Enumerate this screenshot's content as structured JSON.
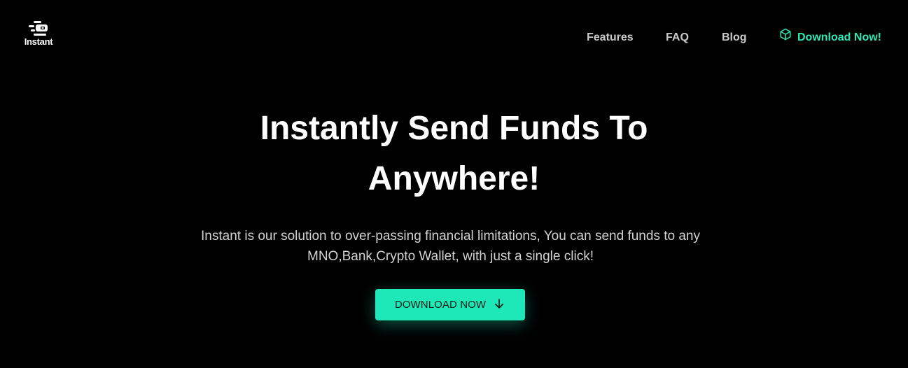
{
  "header": {
    "logo_text": "Instant",
    "logo_icon": "instant-logo-icon",
    "nav": {
      "features": "Features",
      "faq": "FAQ",
      "blog": "Blog",
      "download": "Download Now!",
      "download_icon": "cube-icon"
    }
  },
  "hero": {
    "title_line1": "Instantly Send Funds To",
    "title_line2": "Anywhere!",
    "subtitle": "Instant is our solution to over-passing financial limitations, You can send funds to any MNO,Bank,Crypto Wallet, with just a single click!",
    "cta_label": "DOWNLOAD NOW",
    "cta_icon": "arrow-down-icon"
  },
  "colors": {
    "background": "#000000",
    "accent": "#1fe8b8",
    "nav_text": "#c9c9c9",
    "title_text": "#ffffff"
  }
}
